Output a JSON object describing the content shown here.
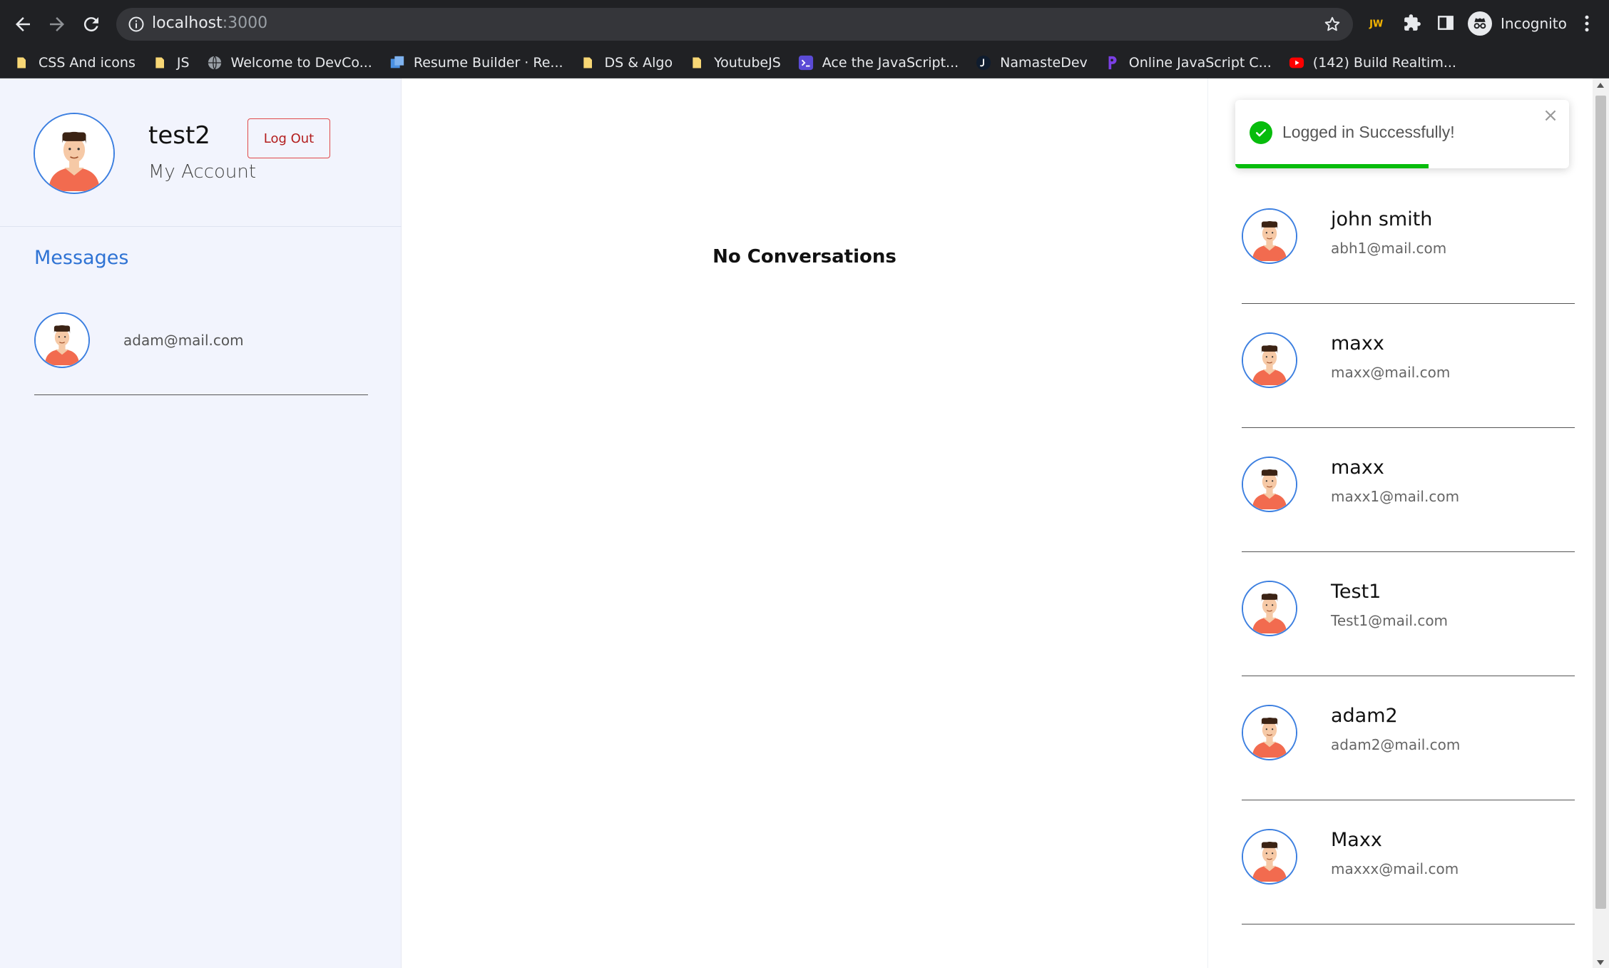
{
  "browser": {
    "url_host": "localhost",
    "url_port": ":3000",
    "profile_label": "Incognito",
    "bookmarks": [
      {
        "label": "CSS And icons",
        "icon": "folder-icon"
      },
      {
        "label": "JS",
        "icon": "folder-icon"
      },
      {
        "label": "Welcome to DevCo...",
        "icon": "globe-icon"
      },
      {
        "label": "Resume Builder · Re...",
        "icon": "resume-icon"
      },
      {
        "label": "DS & Algo",
        "icon": "folder-icon"
      },
      {
        "label": "YoutubeJS",
        "icon": "folder-icon"
      },
      {
        "label": "Ace the JavaScript...",
        "icon": "terminal-icon"
      },
      {
        "label": "NamasteDev",
        "icon": "namastedev-icon"
      },
      {
        "label": "Online JavaScript C...",
        "icon": "code-icon"
      },
      {
        "label": "(142) Build Realtim...",
        "icon": "youtube-icon"
      }
    ]
  },
  "account": {
    "username": "test2",
    "subtitle": "My Account",
    "logout_label": "Log Out"
  },
  "messages": {
    "title": "Messages",
    "conversations": [
      {
        "email": "adam@mail.com"
      }
    ]
  },
  "chat": {
    "empty_label": "No Conversations"
  },
  "people": {
    "heading": "",
    "list": [
      {
        "name": "john smith",
        "email": "abh1@mail.com"
      },
      {
        "name": "maxx",
        "email": "maxx@mail.com"
      },
      {
        "name": "maxx",
        "email": "maxx1@mail.com"
      },
      {
        "name": "Test1",
        "email": "Test1@mail.com"
      },
      {
        "name": "adam2",
        "email": "adam2@mail.com"
      },
      {
        "name": "Maxx",
        "email": "maxxx@mail.com"
      }
    ]
  },
  "toast": {
    "message": "Logged in Successfully!",
    "progress": 0.58
  },
  "colors": {
    "accent_blue": "#2f73d4",
    "logout_red": "#b31d1d",
    "success_green": "#07bc0c",
    "sidebar_bg": "#f2f4fd"
  }
}
